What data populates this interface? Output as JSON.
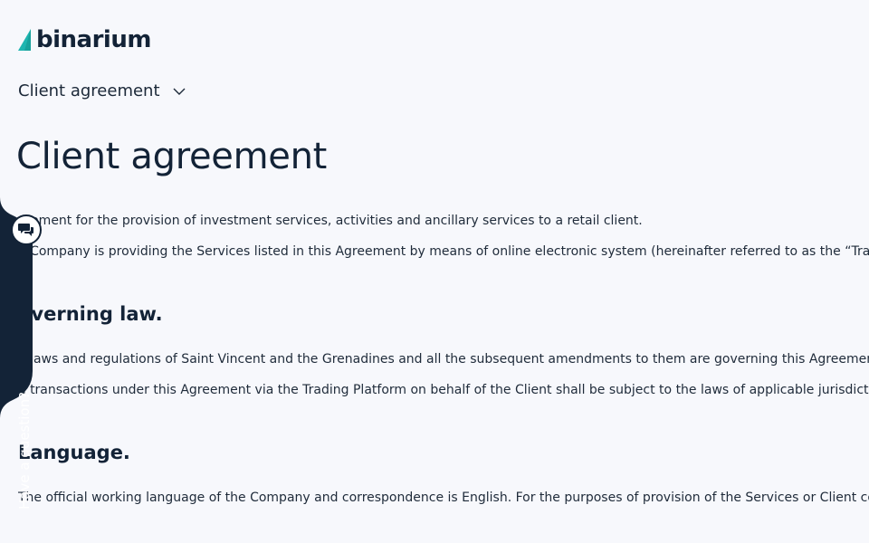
{
  "brand": {
    "name": "binarium",
    "accent_color": "#1fb5b0",
    "text_color": "#132337"
  },
  "doc_selector": {
    "label": "Client agreement",
    "icon": "chevron-down-icon"
  },
  "page_title": "Client agreement",
  "intro": {
    "p1": "reement for the provision of investment services, activities and ancillary services to a retail client.",
    "p2": "e Company is providing the Services listed in this Agreement by means of online electronic system (hereinafter referred to as the “Trading Platform”"
  },
  "sections": [
    {
      "heading": "overning law.",
      "paragraphs": [
        "e laws and regulations of Saint Vincent and the Grenadines and all the subsequent amendments to them are governing this Agreement",
        "e transactions under this Agreement via the Trading Platform on behalf of the Client shall be subject to the laws of applicable jurisdiction"
      ]
    },
    {
      "heading": "Language.",
      "paragraphs": [
        "The official working language of the Company and correspondence is English. For the purposes of provision of the Services or Client communication"
      ]
    }
  ],
  "help_tab": {
    "label": "Have a question?",
    "icon": "chat-bubbles-icon",
    "bg_color": "#132337"
  },
  "colors": {
    "page_bg": "#f7f8fc",
    "text": "#1f2b3a"
  }
}
